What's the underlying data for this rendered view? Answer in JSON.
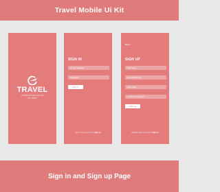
{
  "header": {
    "title": "Travel Mobile Ui Kit"
  },
  "footer": {
    "caption": "Sign in and Sign up Page"
  },
  "splash": {
    "brand": "TRAVEL",
    "tagline_line1": "LOREM IPSUM DOLOR",
    "tagline_line2": "SIT AMET"
  },
  "signin": {
    "title": "SIGN IN",
    "email_placeholder": "E-mail address",
    "password_placeholder": "Password",
    "button_label": "Sign in",
    "footer_text": "Don't have an account?",
    "footer_link": "Sign up"
  },
  "signup": {
    "back_label": "Back",
    "title": "SIGN UP",
    "name_placeholder": "Full name",
    "email_placeholder": "E-mail address",
    "password_placeholder": "Password",
    "confirm_placeholder": "Confirm password",
    "button_label": "Sign up",
    "footer_text": "Already have an account?",
    "footer_link": "Sign in"
  },
  "colors": {
    "accent": "#e07b7b",
    "screen_bg": "#e47c7c",
    "page_bg": "#e8e8e8"
  }
}
